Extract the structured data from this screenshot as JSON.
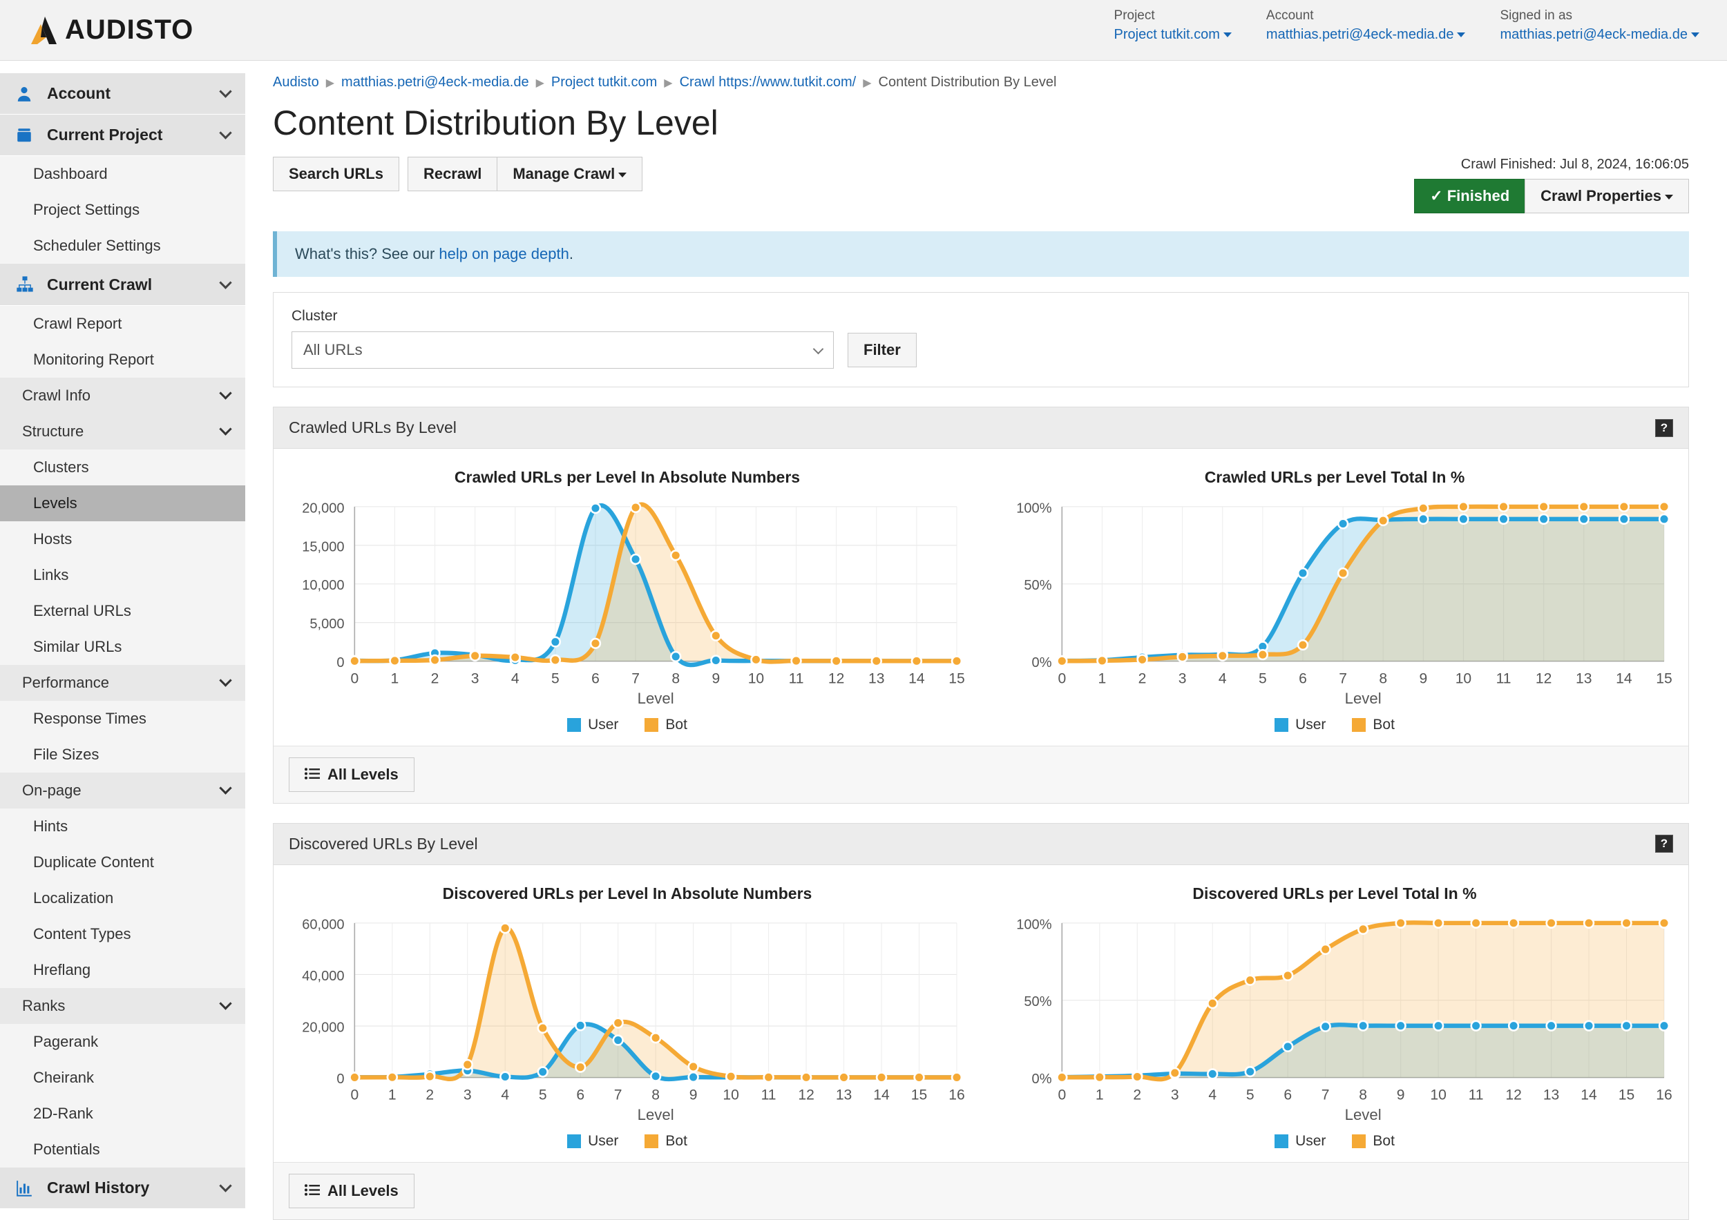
{
  "brand": {
    "name": "AUDISTO",
    "logo_icon": "audisto-logo-icon",
    "orange": "#F0A32E",
    "dark": "#1A1A1A"
  },
  "topnav": [
    {
      "label": "Project",
      "value": "Project tutkit.com"
    },
    {
      "label": "Account",
      "value": "matthias.petri@4eck-media.de"
    },
    {
      "label": "Signed in as",
      "value": "matthias.petri@4eck-media.de"
    }
  ],
  "sidebar": {
    "groups": [
      {
        "label": "Account",
        "icon": "user-icon",
        "items": []
      },
      {
        "label": "Current Project",
        "icon": "briefcase-icon",
        "items": [
          {
            "label": "Dashboard",
            "type": "item",
            "active": false
          },
          {
            "label": "Project Settings",
            "type": "item",
            "active": false
          },
          {
            "label": "Scheduler Settings",
            "type": "item",
            "active": false
          }
        ]
      },
      {
        "label": "Current Crawl",
        "icon": "sitemap-icon",
        "items": [
          {
            "label": "Crawl Report",
            "type": "item",
            "active": false
          },
          {
            "label": "Monitoring Report",
            "type": "item",
            "active": false
          },
          {
            "label": "Crawl Info",
            "type": "section"
          },
          {
            "label": "Structure",
            "type": "section"
          },
          {
            "label": "Clusters",
            "type": "item",
            "active": false
          },
          {
            "label": "Levels",
            "type": "item",
            "active": true
          },
          {
            "label": "Hosts",
            "type": "item",
            "active": false
          },
          {
            "label": "Links",
            "type": "item",
            "active": false
          },
          {
            "label": "External URLs",
            "type": "item",
            "active": false
          },
          {
            "label": "Similar URLs",
            "type": "item",
            "active": false
          },
          {
            "label": "Performance",
            "type": "section"
          },
          {
            "label": "Response Times",
            "type": "item",
            "active": false
          },
          {
            "label": "File Sizes",
            "type": "item",
            "active": false
          },
          {
            "label": "On-page",
            "type": "section"
          },
          {
            "label": "Hints",
            "type": "item",
            "active": false
          },
          {
            "label": "Duplicate Content",
            "type": "item",
            "active": false
          },
          {
            "label": "Localization",
            "type": "item",
            "active": false
          },
          {
            "label": "Content Types",
            "type": "item",
            "active": false
          },
          {
            "label": "Hreflang",
            "type": "item",
            "active": false
          },
          {
            "label": "Ranks",
            "type": "section"
          },
          {
            "label": "Pagerank",
            "type": "item",
            "active": false
          },
          {
            "label": "Cheirank",
            "type": "item",
            "active": false
          },
          {
            "label": "2D-Rank",
            "type": "item",
            "active": false
          },
          {
            "label": "Potentials",
            "type": "item",
            "active": false
          }
        ]
      },
      {
        "label": "Crawl History",
        "icon": "bar-chart-icon",
        "items": []
      }
    ]
  },
  "breadcrumb": [
    {
      "label": "Audisto",
      "link": true
    },
    {
      "label": "matthias.petri@4eck-media.de",
      "link": true
    },
    {
      "label": "Project tutkit.com",
      "link": true
    },
    {
      "label": "Crawl https://www.tutkit.com/",
      "link": true
    },
    {
      "label": "Content Distribution By Level",
      "link": false
    }
  ],
  "page": {
    "title": "Content Distribution By Level"
  },
  "toolbar": {
    "search_urls": "Search URLs",
    "recrawl": "Recrawl",
    "manage_crawl": "Manage Crawl",
    "crawl_timestamp": "Crawl Finished: Jul 8, 2024, 16:06:05",
    "status": "Finished",
    "status_color": "#1F7A33",
    "crawl_properties": "Crawl Properties"
  },
  "banner": {
    "text_before": "What's this? See our ",
    "link": "help on page depth",
    "text_after": "."
  },
  "filter": {
    "label": "Cluster",
    "selected": "All URLs",
    "button": "Filter"
  },
  "panels": [
    {
      "title": "Crawled URLs By Level",
      "help": "?",
      "all_levels": "All Levels"
    },
    {
      "title": "Discovered URLs By Level",
      "help": "?",
      "all_levels": "All Levels"
    }
  ],
  "legend": [
    {
      "label": "User",
      "color": "#29A3DC"
    },
    {
      "label": "Bot",
      "color": "#F5A935"
    }
  ],
  "chart_data": [
    {
      "type": "area",
      "id": "crawled-absolute",
      "title": "Crawled URLs per Level In Absolute Numbers",
      "xlabel": "Level",
      "ylabel": "",
      "x": [
        0,
        1,
        2,
        3,
        4,
        5,
        6,
        7,
        8,
        9,
        10,
        11,
        12,
        13,
        14,
        15
      ],
      "ylim": [
        0,
        20000
      ],
      "yticks": [
        0,
        5000,
        10000,
        15000,
        20000
      ],
      "ytick_labels": [
        "0",
        "5,000",
        "10,000",
        "15,000",
        "20,000"
      ],
      "grid": true,
      "legend_position": "bottom",
      "series": [
        {
          "name": "User",
          "color": "#29A3DC",
          "values": [
            60,
            120,
            1050,
            800,
            120,
            2500,
            19800,
            13200,
            600,
            100,
            40,
            30,
            25,
            20,
            20,
            20
          ]
        },
        {
          "name": "Bot",
          "color": "#F5A935",
          "values": [
            30,
            60,
            150,
            700,
            500,
            150,
            2300,
            19900,
            13700,
            3300,
            200,
            50,
            30,
            25,
            20,
            20
          ]
        }
      ]
    },
    {
      "type": "area",
      "id": "crawled-percent",
      "title": "Crawled URLs per Level Total In %",
      "xlabel": "Level",
      "ylabel": "",
      "x": [
        0,
        1,
        2,
        3,
        4,
        5,
        6,
        7,
        8,
        9,
        10,
        11,
        12,
        13,
        14,
        15
      ],
      "ylim": [
        0,
        100
      ],
      "yticks": [
        0,
        50,
        100
      ],
      "ytick_labels": [
        "0%",
        "50%",
        "100%"
      ],
      "grid": true,
      "legend_position": "bottom",
      "series": [
        {
          "name": "User",
          "color": "#29A3DC",
          "values": [
            0.2,
            0.6,
            2.5,
            4.0,
            4.5,
            9.5,
            57,
            89,
            91.5,
            92,
            92,
            92,
            92,
            92,
            92,
            92
          ]
        },
        {
          "name": "Bot",
          "color": "#F5A935",
          "values": [
            0.1,
            0.3,
            1.0,
            2.8,
            3.5,
            4.2,
            10.5,
            57,
            91,
            99,
            100,
            100,
            100,
            100,
            100,
            100
          ]
        }
      ]
    },
    {
      "type": "area",
      "id": "discovered-absolute",
      "title": "Discovered URLs per Level In Absolute Numbers",
      "xlabel": "Level",
      "ylabel": "",
      "x": [
        0,
        1,
        2,
        3,
        4,
        5,
        6,
        7,
        8,
        9,
        10,
        11,
        12,
        13,
        14,
        15,
        16
      ],
      "ylim": [
        0,
        60000
      ],
      "yticks": [
        0,
        20000,
        40000,
        60000
      ],
      "ytick_labels": [
        "0",
        "20,000",
        "40,000",
        "60,000"
      ],
      "grid": true,
      "legend_position": "bottom",
      "series": [
        {
          "name": "User",
          "color": "#29A3DC",
          "values": [
            100,
            200,
            1300,
            2700,
            300,
            2200,
            20200,
            14500,
            500,
            150,
            80,
            60,
            50,
            50,
            50,
            50,
            50
          ]
        },
        {
          "name": "Bot",
          "color": "#F5A935",
          "values": [
            50,
            100,
            400,
            5000,
            58000,
            19200,
            4000,
            21200,
            15400,
            4200,
            400,
            100,
            60,
            50,
            50,
            50,
            50
          ]
        }
      ]
    },
    {
      "type": "area",
      "id": "discovered-percent",
      "title": "Discovered URLs per Level Total In %",
      "xlabel": "Level",
      "ylabel": "",
      "x": [
        0,
        1,
        2,
        3,
        4,
        5,
        6,
        7,
        8,
        9,
        10,
        11,
        12,
        13,
        14,
        15,
        16
      ],
      "ylim": [
        0,
        100
      ],
      "yticks": [
        0,
        50,
        100
      ],
      "ytick_labels": [
        "0%",
        "50%",
        "100%"
      ],
      "grid": true,
      "legend_position": "bottom",
      "series": [
        {
          "name": "User",
          "color": "#29A3DC",
          "values": [
            0.2,
            0.6,
            1.2,
            2.5,
            2.3,
            3.8,
            20,
            33,
            33.5,
            33.5,
            33.5,
            33.5,
            33.5,
            33.5,
            33.5,
            33.5,
            33.5
          ]
        },
        {
          "name": "Bot",
          "color": "#F5A935",
          "values": [
            0.1,
            0.2,
            0.5,
            3.0,
            48,
            63,
            66,
            83,
            96,
            100,
            100,
            100,
            100,
            100,
            100,
            100,
            100
          ]
        }
      ]
    }
  ]
}
